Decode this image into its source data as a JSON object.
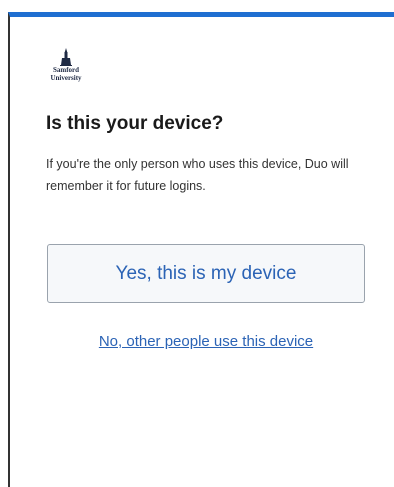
{
  "branding": {
    "logo_line1": "Samford",
    "logo_line2": "University"
  },
  "prompt": {
    "title": "Is this your device?",
    "description": "If you're the only person who uses this device, Duo will remember it for future logins."
  },
  "actions": {
    "yes_label": "Yes, this is my device",
    "no_label": "No, other people use this device"
  },
  "colors": {
    "accent_bar": "#1f6fd1",
    "link": "#2b63b5"
  }
}
